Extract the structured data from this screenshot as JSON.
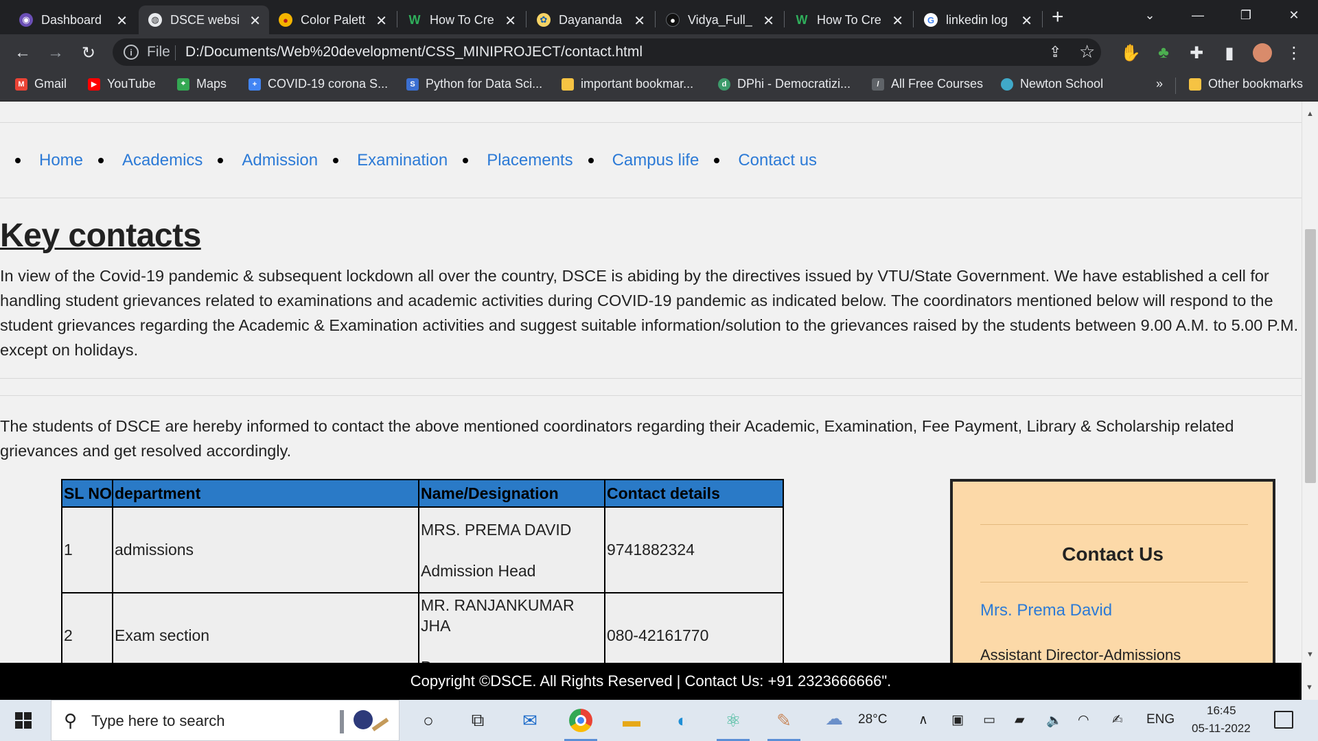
{
  "browser": {
    "tabs": [
      {
        "title": "Dashboard",
        "icon": "dashboard-icon",
        "active": false
      },
      {
        "title": "DSCE websi",
        "icon": "globe-icon",
        "active": true
      },
      {
        "title": "Color Palett",
        "icon": "palette-icon",
        "active": false
      },
      {
        "title": "How To Cre",
        "icon": "w-icon",
        "active": false
      },
      {
        "title": "Dayananda",
        "icon": "college-icon",
        "active": false
      },
      {
        "title": "Vidya_Full_",
        "icon": "github-icon",
        "active": false
      },
      {
        "title": "How To Cre",
        "icon": "w-icon",
        "active": false
      },
      {
        "title": "linkedin log",
        "icon": "google-icon",
        "active": false
      }
    ],
    "address": {
      "scheme_label": "File",
      "url": "D:/Documents/Web%20development/CSS_MINIPROJECT/contact.html"
    },
    "bookmarks": [
      {
        "label": "Gmail",
        "icon": "gmail-icon",
        "color": "#ea4335"
      },
      {
        "label": "YouTube",
        "icon": "youtube-icon",
        "color": "#ff0000"
      },
      {
        "label": "Maps",
        "icon": "maps-icon",
        "color": "#34a853"
      },
      {
        "label": "COVID-19 corona S...",
        "icon": "covid-icon",
        "color": "#4285f4"
      },
      {
        "label": "Python for Data Sci...",
        "icon": "python-icon",
        "color": "#3b6fd1"
      },
      {
        "label": "important bookmar...",
        "icon": "folder-icon",
        "color": "#f6c343"
      },
      {
        "label": "DPhi - Democratizi...",
        "icon": "dphi-icon",
        "color": "#3d9b6b"
      },
      {
        "label": "All Free Courses",
        "icon": "courses-icon",
        "color": "#5f6368"
      },
      {
        "label": "Newton School",
        "icon": "newton-icon",
        "color": "#40a9c9"
      }
    ],
    "bookmarks_overflow": "»",
    "other_bookmarks": "Other bookmarks"
  },
  "page": {
    "nav": [
      "Home",
      "Academics",
      "Admission",
      "Examination",
      "Placements",
      "Campus life",
      "Contact us"
    ],
    "heading": "Key contacts",
    "intro": "In view of the Covid-19 pandemic & subsequent lockdown all over the country, DSCE is abiding by the directives issued by VTU/State Government. We have established a cell for handling student grievances related to examinations and academic activities during COVID-19 pandemic as indicated below. The coordinators mentioned below will respond to the student grievances regarding the Academic & Examination activities and suggest suitable information/solution to the grievances raised by the students between 9.00 A.M. to 5.00 P.M. except on holidays.",
    "students_note": "The students of DSCE are hereby informed to contact the above mentioned coordinators regarding their Academic, Examination, Fee Payment, Library & Scholarship related grievances and get resolved accordingly.",
    "table": {
      "headers": [
        "SL NO",
        "department",
        "Name/Designation",
        "Contact details"
      ],
      "rows": [
        {
          "sl": "1",
          "department": "admissions",
          "name": "MRS. PREMA DAVID",
          "designation": "Admission Head",
          "contact": "9741882324"
        },
        {
          "sl": "2",
          "department": "Exam section",
          "name": "MR. RANJANKUMAR JHA",
          "designation": "Programmer",
          "contact": "080-42161770"
        }
      ]
    },
    "contact_box": {
      "title": "Contact Us",
      "name": "Mrs. Prema David",
      "role": "Assistant Director-Admissions"
    },
    "footer": "Copyright ©DSCE. All Rights Reserved | Contact Us: +91 2323666666\"."
  },
  "taskbar": {
    "search_placeholder": "Type here to search",
    "weather": "28°C",
    "language": "ENG",
    "time": "16:45",
    "date": "05-11-2022"
  },
  "colors": {
    "link": "#2c7ad6",
    "table_header": "#2a7ac7",
    "contact_box_bg": "#fcd9a8",
    "footer_bg": "#000000",
    "browser_frame": "#202124"
  }
}
